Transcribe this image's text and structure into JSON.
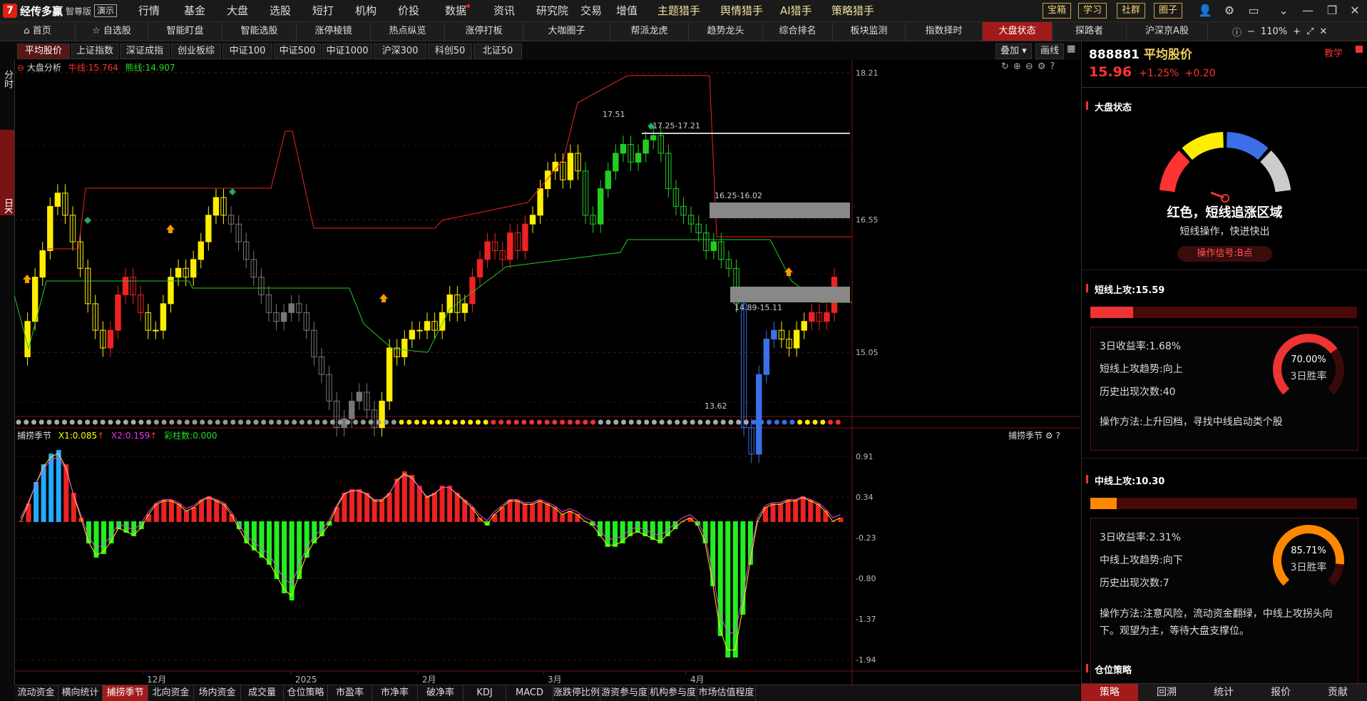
{
  "app": {
    "name": "经传多赢",
    "edition": "智尊版",
    "demo": "演示"
  },
  "top_menu": [
    "行情",
    "基金",
    "大盘",
    "选股",
    "短打",
    "机构",
    "价投",
    "数据",
    "资讯",
    "研究院",
    "交易",
    "增值",
    "主题猎手",
    "舆情猎手",
    "AI猎手",
    "策略猎手"
  ],
  "top_buttons": [
    "宝箱",
    "学习",
    "社群",
    "圈子"
  ],
  "nav_tabs": [
    "首页",
    "自选股",
    "智能盯盘",
    "智能选股",
    "涨停棱镜",
    "热点纵览",
    "涨停打板",
    "大咖圈子",
    "帮派龙虎",
    "趋势龙头",
    "综合排名",
    "板块监测",
    "指数择时",
    "大盘状态",
    "探路者",
    "沪深京A股"
  ],
  "nav_active": "大盘状态",
  "zoom": "110%",
  "left_tabs": [
    "分时",
    "日K"
  ],
  "index_tabs": [
    "平均股价",
    "上证指数",
    "深证成指",
    "创业板综",
    "中证100",
    "中证500",
    "中证1000",
    "沪深300",
    "科创50",
    "北证50"
  ],
  "index_active": "平均股价",
  "chart_tools": {
    "overlay": "叠加",
    "draw": "画线"
  },
  "indicator_main": {
    "name": "大盘分析",
    "bull_label": "牛线:15.764",
    "bear_label": "熊线:14.907"
  },
  "sub_indicator": {
    "name": "捕捞季节",
    "x1": "X1:0.085",
    "x2": "X2:0.159",
    "bars": "彩柱数:0.000",
    "right_label": "捕捞季节"
  },
  "y_axis_main": [
    "18.21",
    "16.55",
    "15.05"
  ],
  "y_axis_sub": [
    "0.91",
    "0.34",
    "-0.23",
    "-0.80",
    "-1.37",
    "-1.94"
  ],
  "x_axis": [
    "12月",
    "2025",
    "2月",
    "3月",
    "4月"
  ],
  "annotations": {
    "high": "17.51",
    "zone1": "17.25-17.21",
    "zone2": "16.25-16.02",
    "zone3": "14.89-15.11",
    "low": "13.62"
  },
  "bottom_tabs": [
    "流动资金",
    "横向统计",
    "捕捞季节",
    "北向资金",
    "场内资金",
    "成交量",
    "仓位策略",
    "市盈率",
    "市净率",
    "破净率",
    "KDJ",
    "MACD",
    "涨跌停比例",
    "游资参与度",
    "机构参与度",
    "市场估值程度"
  ],
  "bottom_active": "捕捞季节",
  "stock": {
    "code": "888881",
    "name": "平均股价",
    "price": "15.96",
    "pct": "+1.25%",
    "chg": "+0.20",
    "teach": "教学"
  },
  "market_state": {
    "title": "大盘状态",
    "status": "红色，短线追涨区域",
    "advice": "短线操作，快进快出",
    "signal": "操作信号:B点",
    "colors": [
      "#ff3333",
      "#ffee00",
      "#3d6ee8",
      "#cccccc"
    ]
  },
  "short": {
    "title": "短线上攻:15.59",
    "bar_fraction": 0.16,
    "color": "#ee3333",
    "rate_label": "3日收益率:",
    "rate": "1.68%",
    "trend_label": "短线上攻趋势:",
    "trend": "向上",
    "count_label": "历史出现次数:",
    "count": "40",
    "method_label": "操作方法:",
    "method": "上升回档，寻找中线启动类个股",
    "win": "70.00%",
    "win_fraction": 0.7,
    "win_label": "3日胜率"
  },
  "mid": {
    "title": "中线上攻:10.30",
    "bar_fraction": 0.1,
    "color": "#ff8800",
    "rate_label": "3日收益率:",
    "rate": "2.31%",
    "trend_label": "中线上攻趋势:",
    "trend": "向下",
    "count_label": "历史出现次数:",
    "count": "7",
    "method_label": "操作方法:",
    "method": "注意风险，流动资金翻绿，中线上攻拐头向下。观望为主，等待大盘支撑位。",
    "win": "85.71%",
    "win_fraction": 0.8571,
    "win_label": "3日胜率"
  },
  "position_title": "仓位策略",
  "right_bottom_tabs": [
    "策略",
    "回溯",
    "统计",
    "报价",
    "贡献"
  ],
  "right_bottom_active": "策略"
}
